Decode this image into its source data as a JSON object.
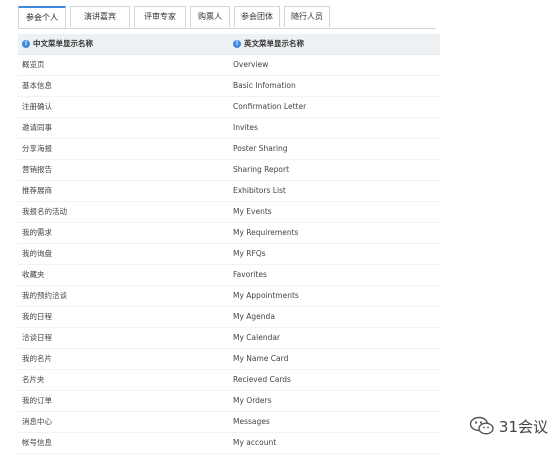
{
  "tabs": [
    {
      "label": "参会个人",
      "active": true
    },
    {
      "label": "演讲嘉宾",
      "active": false
    },
    {
      "label": "评审专家",
      "active": false
    },
    {
      "label": "购票人",
      "active": false
    },
    {
      "label": "参会团体",
      "active": false
    },
    {
      "label": "随行人员",
      "active": false
    }
  ],
  "table": {
    "headers": [
      "中文菜单显示名称",
      "英文菜单显示名称"
    ],
    "header_icon": "info-icon",
    "rows": [
      [
        "概览页",
        "Overview"
      ],
      [
        "基本信息",
        "Basic Infomation"
      ],
      [
        "注册确认",
        "Confirmation Letter"
      ],
      [
        "邀请同事",
        "Invites"
      ],
      [
        "分享海报",
        "Poster Sharing"
      ],
      [
        "营销报告",
        "Sharing Report"
      ],
      [
        "推荐展商",
        "Exhibitors List"
      ],
      [
        "我报名的活动",
        "My Events"
      ],
      [
        "我的需求",
        "My Requirements"
      ],
      [
        "我的询盘",
        "My RFQs"
      ],
      [
        "收藏夹",
        "Favorites"
      ],
      [
        "我的预约洽谈",
        "My Appointments"
      ],
      [
        "我的日程",
        "My Agenda"
      ],
      [
        "洽谈日程",
        "My Calendar"
      ],
      [
        "我的名片",
        "My Name Card"
      ],
      [
        "名片夹",
        "Recieved Cards"
      ],
      [
        "我的订单",
        "My Orders"
      ],
      [
        "消息中心",
        "Messages"
      ],
      [
        "帐号信息",
        "My account"
      ]
    ]
  },
  "watermark": {
    "text": "31会议",
    "icon": "wechat-icon"
  },
  "colors": {
    "accent": "#3b8be0",
    "header_bg": "#eef1f4"
  }
}
